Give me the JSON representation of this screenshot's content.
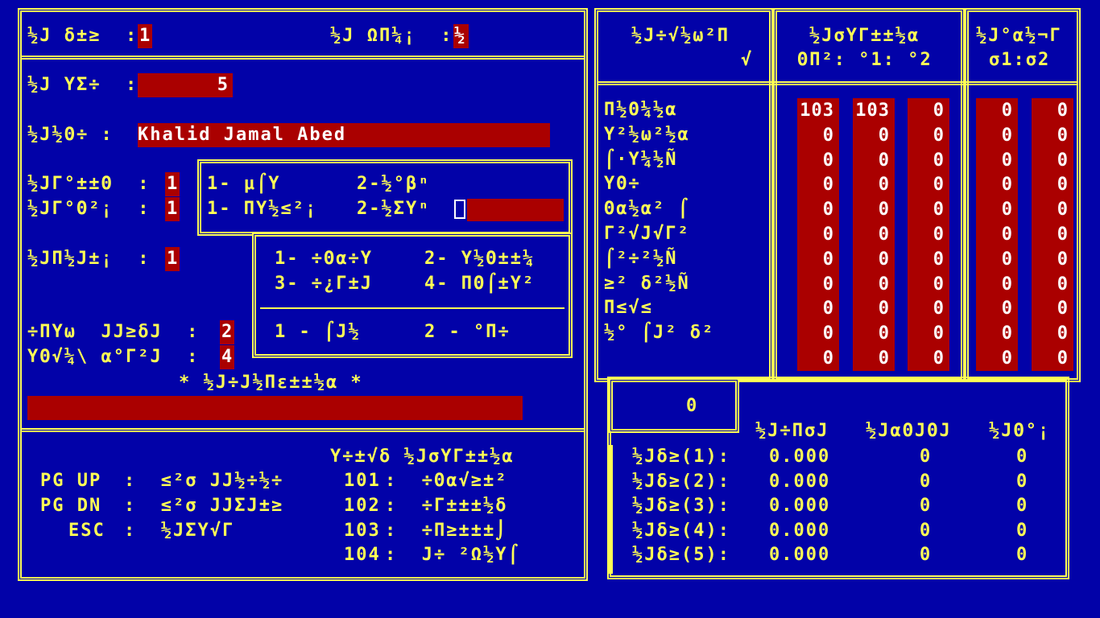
{
  "left_panel": {
    "row1_label_a": "½J δ±≥  :",
    "row1_value_a": "1",
    "row1_label_b": "½J ΩΠ¼¡  :",
    "row1_value_b": "½",
    "row2_label": "½J ΥΣ÷  :",
    "row2_value": "5",
    "row3_label": "½J½Θ÷ :",
    "row3_value": "Khalid Jamal Abed",
    "row4a_label": "½JΓ°±±Θ  :",
    "row4a_value": "1",
    "row4b_label": "½JΓ°Θ²¡  :",
    "row4b_value": "1",
    "row5_label": "½JΠ½J±¡  :",
    "row5_value": "1",
    "row6a_label": "÷ΠΥω  JJ≥δJ  :",
    "row6a_value": "2",
    "row6b_label": "ΥΘ√¼\\ α°Γ²J  :",
    "row6b_value": "4",
    "section_title": "* ½J÷J½Πε±±½α *"
  },
  "popup_small": {
    "line1_a": "1- μ⌠Υ",
    "line1_b": "2-½°βⁿ",
    "line2_a": "1- ΠΥ½≤²¡",
    "line2_b": "2-½ΣΥⁿ"
  },
  "popup_large": {
    "line1_a": "1- ÷Θα÷Υ",
    "line1_b": "2- Υ½Θ±±¼",
    "line2_a": "3- ÷¿Γ±J",
    "line2_b": "4- ΠΘ⌠±Υ²",
    "line3_a": "1 - ⌠J½",
    "line3_b": "2 - °Π÷"
  },
  "keys": {
    "pgup_key": "PG UP",
    "pgup_desc": ":  ≤²σ JJ½÷½÷",
    "pgdn_key": "PG DN",
    "pgdn_desc": ":  ≤²σ JJΣJ±≥",
    "esc_key": "ESC",
    "esc_desc": ":  ½JΣΥ√Γ",
    "codes_title": "Υ÷±√δ ½JσΥΓ±±½α",
    "codes": [
      {
        "code": "101",
        "desc": ":  ÷Θα√≥±²"
      },
      {
        "code": "102",
        "desc": ":  ÷Γ±±±½δ"
      },
      {
        "code": "103",
        "desc": ":  ÷Π≥±±±⌡"
      },
      {
        "code": "104",
        "desc": ":  J÷ ²Ω½Υ⌠"
      }
    ]
  },
  "right_table": {
    "header_col1_l1": "½J÷√½ω²Π",
    "header_col1_l2": "√",
    "header_col2_l1": "½JσΥΓ±±½α",
    "header_col2_l2": "ΘΠ²: °1: °2",
    "header_col3_l1": "½J°α½¬Γ",
    "header_col3_l2": "σ1:σ2",
    "rows": [
      {
        "label": "Π½Θ¼½α",
        "v": [
          "103",
          "103",
          "0",
          "0",
          "0"
        ]
      },
      {
        "label": "Υ²½ω²½α",
        "v": [
          "0",
          "0",
          "0",
          "0",
          "0"
        ]
      },
      {
        "label": "⌠·Υ¼½Ñ",
        "v": [
          "0",
          "0",
          "0",
          "0",
          "0"
        ]
      },
      {
        "label": "ΥΘ÷",
        "v": [
          "0",
          "0",
          "0",
          "0",
          "0"
        ]
      },
      {
        "label": "Θα½α² ⌠",
        "v": [
          "0",
          "0",
          "0",
          "0",
          "0"
        ]
      },
      {
        "label": "Γ²√J√Γ²",
        "v": [
          "0",
          "0",
          "0",
          "0",
          "0"
        ]
      },
      {
        "label": "⌠²÷²½Ñ",
        "v": [
          "0",
          "0",
          "0",
          "0",
          "0"
        ]
      },
      {
        "label": "≥² δ²½Ñ",
        "v": [
          "0",
          "0",
          "0",
          "0",
          "0"
        ]
      },
      {
        "label": "Π≤√≤",
        "v": [
          "0",
          "0",
          "0",
          "0",
          "0"
        ]
      },
      {
        "label": "½° ⌠J² δ²",
        "v": [
          "0",
          "0",
          "0",
          "0",
          "0"
        ]
      },
      {
        "label": "",
        "v": [
          "0",
          "0",
          "0",
          "0",
          "0"
        ]
      }
    ]
  },
  "summary": {
    "counter": "0",
    "col1": "½J÷ΠσJ",
    "col2": "½JαΘJΘJ",
    "col3": "½JΘ°¡",
    "rows": [
      {
        "label": "½Jδ≥(1):",
        "a": "0.000",
        "b": "0",
        "c": "0"
      },
      {
        "label": "½Jδ≥(2):",
        "a": "0.000",
        "b": "0",
        "c": "0"
      },
      {
        "label": "½Jδ≥(3):",
        "a": "0.000",
        "b": "0",
        "c": "0"
      },
      {
        "label": "½Jδ≥(4):",
        "a": "0.000",
        "b": "0",
        "c": "0"
      },
      {
        "label": "½Jδ≥(5):",
        "a": "0.000",
        "b": "0",
        "c": "0"
      }
    ]
  },
  "colors": {
    "background": "#0202a8",
    "foreground": "#ffff55",
    "field": "#aa0000",
    "value_text": "#ffffff"
  }
}
